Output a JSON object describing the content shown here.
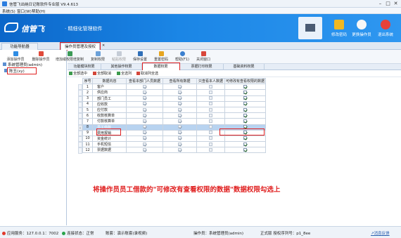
{
  "titlebar": {
    "title": "信管飞出纳日记账软件专业版 V9.4.613",
    "minimize": "–",
    "maximize": "□",
    "close": "✕"
  },
  "menubar": {
    "items": [
      "系统(S)",
      "窗口(W)",
      "帮助(H)"
    ]
  },
  "banner": {
    "brand": "信管飞",
    "slogan": "· 精细化管理软件",
    "buttons": [
      {
        "label": "修改密码",
        "icon": "lock-icon"
      },
      {
        "label": "更换操作员",
        "icon": "user-icon"
      },
      {
        "label": "退出系统",
        "icon": "power-icon"
      }
    ]
  },
  "navtabs": [
    {
      "label": "功能导航器"
    },
    {
      "label": "操作员管理及授权",
      "close": "✕"
    }
  ],
  "leftpanel": {
    "items": [
      "系统管理员(admin)",
      "陈丑(xy)"
    ]
  },
  "toolbar": {
    "items": [
      "添加操作员",
      "删除操作员",
      "增加或权限增复制",
      "复制权限",
      "粘贴权限",
      "保存设置",
      "重置密码",
      "帮助(F1)",
      "关闭窗口"
    ]
  },
  "subtabs": [
    "功能模块权限",
    "其他操作权限",
    "数据权限",
    "票据打印权限",
    "基础资料权限"
  ],
  "actions": [
    "全部选中",
    "全部取消",
    "全选列",
    "取消列全选"
  ],
  "grid": {
    "headers": [
      "序号",
      "数据内容",
      "查看本部门人员数据",
      "查看所有数据",
      "只查看本人数据",
      "可修改有查看权限的数据"
    ],
    "rows": [
      {
        "no": "1",
        "name": "客户",
        "c1": true,
        "c2": true,
        "c3": false,
        "c4": true
      },
      {
        "no": "2",
        "name": "供应商",
        "c1": true,
        "c2": true,
        "c3": false,
        "c4": true
      },
      {
        "no": "3",
        "name": "部门员工",
        "c1": true,
        "c2": true,
        "c3": false,
        "c4": true
      },
      {
        "no": "4",
        "name": "应收款",
        "c1": true,
        "c2": true,
        "c3": false,
        "c4": true
      },
      {
        "no": "5",
        "name": "应付款",
        "c1": true,
        "c2": true,
        "c3": false,
        "c4": true
      },
      {
        "no": "6",
        "name": "收款核算单",
        "c1": true,
        "c2": true,
        "c3": false,
        "c4": true
      },
      {
        "no": "7",
        "name": "付款核算单",
        "c1": true,
        "c2": true,
        "c3": false,
        "c4": true
      },
      {
        "no": "8",
        "name": "员工借款",
        "c1": true,
        "c2": true,
        "c3": false,
        "c4": true
      },
      {
        "no": "9",
        "name": "费用报销",
        "c1": true,
        "c2": true,
        "c3": false,
        "c4": true
      },
      {
        "no": "10",
        "name": "资金统计",
        "c1": true,
        "c2": true,
        "c3": false,
        "c4": true
      },
      {
        "no": "11",
        "name": "手机短信",
        "c1": true,
        "c2": true,
        "c3": false,
        "c4": true
      },
      {
        "no": "12",
        "name": "票据数据",
        "c1": true,
        "c2": true,
        "c3": false,
        "c4": true
      }
    ],
    "selected_row": 7
  },
  "caption": "将操作员员工借款的\"可修改有查看权限的数据\"数据权限勾选上",
  "statusbar": {
    "server": "应用服务：127.0.0.1：7002",
    "conn": "连接状态：正常",
    "account": "账套：演示账套(录视频)",
    "operator": "操作员：系统管理员(admin)",
    "version": "正式版 授权序列号：p1_8ee",
    "feedback": "↗消息反馈"
  },
  "colors": {
    "accent": "#1b86e6",
    "annotation": "#e02020"
  }
}
